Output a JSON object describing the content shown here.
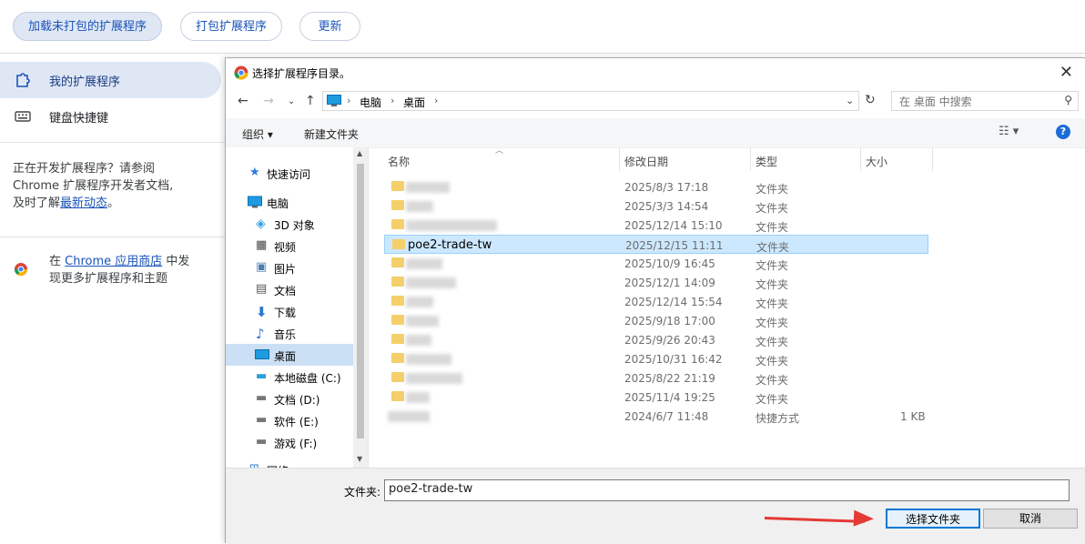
{
  "topbar": {
    "load_unpacked": "加载未打包的扩展程序",
    "pack_extension": "打包扩展程序",
    "update": "更新"
  },
  "sidebar": {
    "items": [
      {
        "label": "我的扩展程序",
        "icon": "puzzle-icon",
        "active": true
      },
      {
        "label": "键盘快捷键",
        "icon": "keyboard-icon",
        "active": false
      }
    ],
    "dev_text_1": "正在开发扩展程序？请参阅",
    "dev_text_2": "Chrome 扩展程序开发者文档,",
    "dev_text_3": "及时了解",
    "dev_link": "最新动态",
    "dev_text_4": "。",
    "store_text_1": "在",
    "store_link": "Chrome 应用商店",
    "store_text_2": "中发",
    "store_text_3": "现更多扩展程序和主题"
  },
  "dialog": {
    "title": "选择扩展程序目录。",
    "breadcrumb": [
      "电脑",
      "桌面"
    ],
    "search_placeholder": "在 桌面 中搜索",
    "toolbar": {
      "organize": "组织 ▾",
      "new_folder": "新建文件夹"
    },
    "tree": [
      {
        "label": "快速访问",
        "icon": "star-icon"
      },
      {
        "label": "电脑",
        "icon": "computer-icon"
      },
      {
        "label": "3D 对象",
        "icon": "cube-icon"
      },
      {
        "label": "视频",
        "icon": "film-icon"
      },
      {
        "label": "图片",
        "icon": "picture-icon"
      },
      {
        "label": "文档",
        "icon": "document-icon"
      },
      {
        "label": "下载",
        "icon": "download-icon"
      },
      {
        "label": "音乐",
        "icon": "music-icon"
      },
      {
        "label": "桌面",
        "icon": "desktop-icon",
        "selected": true
      },
      {
        "label": "本地磁盘 (C:)",
        "icon": "drive-icon"
      },
      {
        "label": "文档 (D:)",
        "icon": "drive-icon"
      },
      {
        "label": "软件 (E:)",
        "icon": "drive-icon"
      },
      {
        "label": "游戏 (F:)",
        "icon": "drive-icon"
      },
      {
        "label": "网络",
        "icon": "network-icon"
      }
    ],
    "columns": [
      "名称",
      "修改日期",
      "类型",
      "大小"
    ],
    "files": [
      {
        "name": "",
        "date": "2025/8/3 17:18",
        "type": "文件夹",
        "size": ""
      },
      {
        "name": "",
        "date": "2025/3/3 14:54",
        "type": "文件夹",
        "size": ""
      },
      {
        "name": "",
        "date": "2025/12/14 15:10",
        "type": "文件夹",
        "size": ""
      },
      {
        "name": "poe2-trade-tw",
        "date": "2025/12/15 11:11",
        "type": "文件夹",
        "size": "",
        "selected": true
      },
      {
        "name": "",
        "date": "2025/10/9 16:45",
        "type": "文件夹",
        "size": ""
      },
      {
        "name": "",
        "date": "2025/12/1 14:09",
        "type": "文件夹",
        "size": ""
      },
      {
        "name": "",
        "date": "2025/12/14 15:54",
        "type": "文件夹",
        "size": ""
      },
      {
        "name": "",
        "date": "2025/9/18 17:00",
        "type": "文件夹",
        "size": ""
      },
      {
        "name": "",
        "date": "2025/9/26 20:43",
        "type": "文件夹",
        "size": ""
      },
      {
        "name": "",
        "date": "2025/10/31 16:42",
        "type": "文件夹",
        "size": ""
      },
      {
        "name": "",
        "date": "2025/8/22 21:19",
        "type": "文件夹",
        "size": ""
      },
      {
        "name": "",
        "date": "2025/11/4 19:25",
        "type": "文件夹",
        "size": ""
      },
      {
        "name": "",
        "date": "2024/6/7 11:48",
        "type": "快捷方式",
        "size": "1 KB"
      }
    ],
    "filename_label": "文件夹:",
    "filename_value": "poe2-trade-tw",
    "select_button": "选择文件夹",
    "cancel_button": "取消"
  },
  "colors": {
    "accent": "#1a53b8",
    "selection": "#cce8ff",
    "arrow": "#e53935"
  }
}
